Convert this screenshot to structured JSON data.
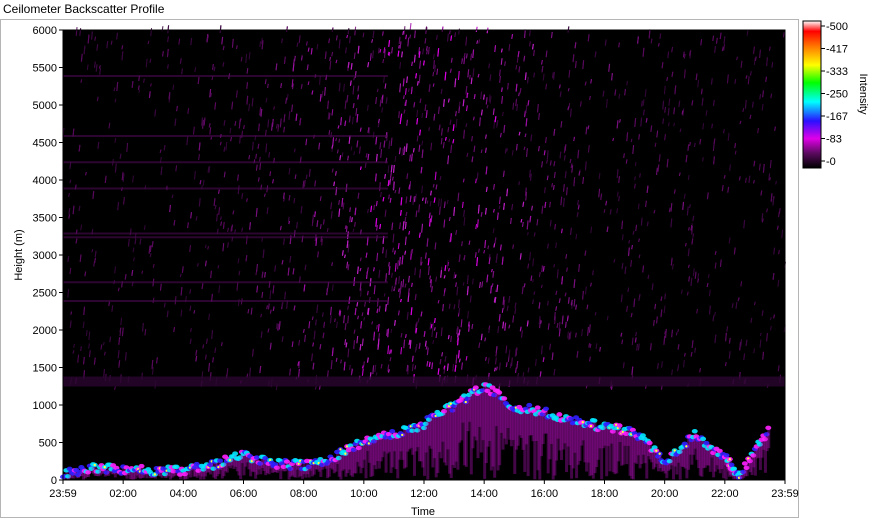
{
  "window": {
    "title": "Ceilometer Backscatter Profile"
  },
  "chart_data": {
    "type": "heatmap",
    "title": "",
    "xlabel": "Time",
    "ylabel": "Height (m)",
    "ylim": [
      0,
      6000
    ],
    "xlim_hours": [
      0,
      24
    ],
    "x_ticks": [
      "23:59",
      "02:00",
      "04:00",
      "06:00",
      "08:00",
      "10:00",
      "12:00",
      "14:00",
      "16:00",
      "18:00",
      "20:00",
      "22:00",
      "23:59"
    ],
    "y_ticks": [
      "0",
      "500",
      "1000",
      "1500",
      "2000",
      "2500",
      "3000",
      "3500",
      "4000",
      "4500",
      "5000",
      "5500",
      "6000"
    ],
    "colorbar": {
      "label": "Intensity",
      "range": [
        0,
        500
      ],
      "ticks": [
        "-500",
        "-417",
        "-333",
        "-250",
        "-167",
        "-83",
        "-0"
      ],
      "colors": [
        "#000000",
        "#5a0a5e",
        "#e000e8",
        "#2a10ff",
        "#00ffff",
        "#00ff00",
        "#ffff00",
        "#ff8000",
        "#ff0000",
        "#ffffff"
      ]
    },
    "cloud_base_layer": [
      {
        "hour": 0.0,
        "height": 90
      },
      {
        "hour": 1.0,
        "height": 160
      },
      {
        "hour": 2.0,
        "height": 140
      },
      {
        "hour": 3.0,
        "height": 120
      },
      {
        "hour": 4.0,
        "height": 130
      },
      {
        "hour": 5.0,
        "height": 200
      },
      {
        "hour": 6.0,
        "height": 330
      },
      {
        "hour": 7.0,
        "height": 220
      },
      {
        "hour": 8.0,
        "height": 200
      },
      {
        "hour": 9.0,
        "height": 300
      },
      {
        "hour": 10.0,
        "height": 520
      },
      {
        "hour": 11.0,
        "height": 600
      },
      {
        "hour": 12.0,
        "height": 750
      },
      {
        "hour": 13.0,
        "height": 1000
      },
      {
        "hour": 14.0,
        "height": 1250
      },
      {
        "hour": 15.0,
        "height": 980
      },
      {
        "hour": 16.0,
        "height": 900
      },
      {
        "hour": 17.0,
        "height": 800
      },
      {
        "hour": 18.0,
        "height": 700
      },
      {
        "hour": 19.0,
        "height": 650
      },
      {
        "hour": 20.0,
        "height": 250
      },
      {
        "hour": 21.0,
        "height": 600
      },
      {
        "hour": 22.0,
        "height": 300
      },
      {
        "hour": 22.5,
        "height": 60
      },
      {
        "hour": 23.5,
        "height": 700
      }
    ],
    "noise_level_peak": 83
  }
}
